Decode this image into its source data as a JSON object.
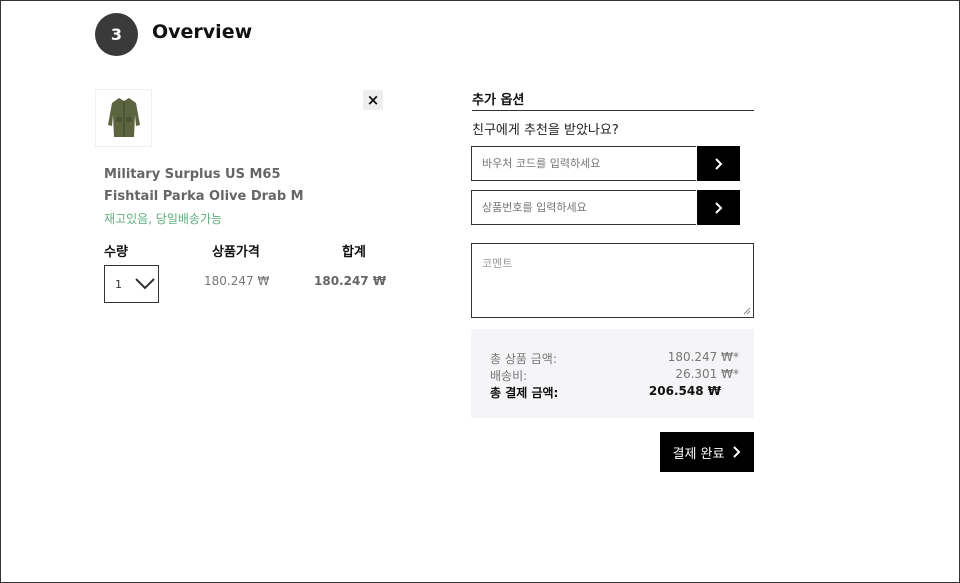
{
  "step": {
    "number": "3",
    "title": "Overview"
  },
  "cart": {
    "item": {
      "name": "Military Surplus US M65 Fishtail Parka Olive Drab M",
      "stock": "재고있음, 당일배송가능",
      "image_icon": "jacket-icon"
    },
    "columns": {
      "qty": "수량",
      "price": "상품가격",
      "total": "합계"
    },
    "qty": "1",
    "price": "180.247 ₩",
    "total": "180.247 ₩",
    "remove_label": "×"
  },
  "options": {
    "title": "추가 옵션",
    "recommend_question": "친구에게 추천을 받았나요?",
    "voucher_placeholder": "바우처 코드를 입력하세요",
    "product_no_placeholder": "상품번호를 입력하세요",
    "comment_placeholder": "코멘트"
  },
  "summary": {
    "subtotal_label": "총 상품 금액:",
    "subtotal": "180.247 ₩*",
    "shipping_label": "배송비:",
    "shipping": "26.301 ₩*",
    "total_label": "총 결제 금액:",
    "total": "206.548 ₩"
  },
  "checkout": {
    "label": "결제 완료"
  },
  "colors": {
    "accent": "#000000",
    "stock_green": "#5fae7e",
    "step_circle": "#3a3a3a"
  }
}
